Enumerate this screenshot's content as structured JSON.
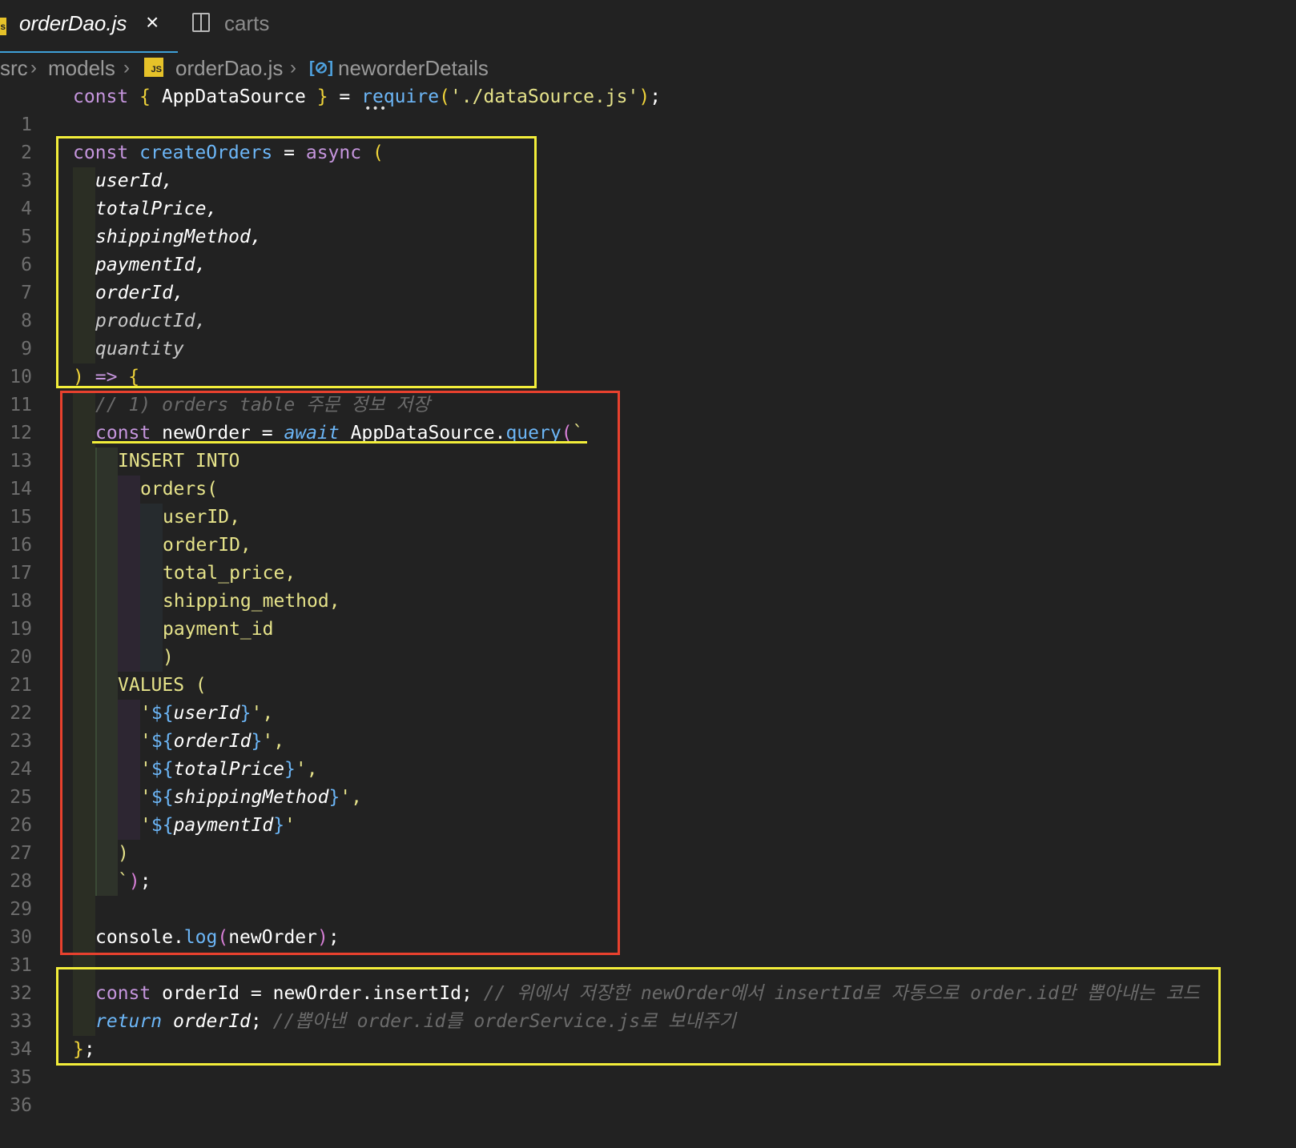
{
  "tabs": [
    {
      "label": "orderDao.js",
      "close_icon": "×"
    },
    {
      "label": "carts"
    }
  ],
  "breadcrumb": [
    "src",
    "models",
    "orderDao.js",
    "neworderDetails"
  ],
  "breadcrumb_sep": "›",
  "icons": {
    "js_file": "JS",
    "symbol": "[⊘]"
  },
  "lines": [
    {
      "n": "1"
    },
    {
      "n": "2"
    },
    {
      "n": "3"
    },
    {
      "n": "4"
    },
    {
      "n": "5"
    },
    {
      "n": "6"
    },
    {
      "n": "7"
    },
    {
      "n": "8"
    },
    {
      "n": "9"
    },
    {
      "n": "10"
    },
    {
      "n": "11"
    },
    {
      "n": "12"
    },
    {
      "n": "13"
    },
    {
      "n": "14"
    },
    {
      "n": "15"
    },
    {
      "n": "16"
    },
    {
      "n": "17"
    },
    {
      "n": "18"
    },
    {
      "n": "19"
    },
    {
      "n": "20"
    },
    {
      "n": "21"
    },
    {
      "n": "22"
    },
    {
      "n": "23"
    },
    {
      "n": "24"
    },
    {
      "n": "25"
    },
    {
      "n": "26"
    },
    {
      "n": "27"
    },
    {
      "n": "28"
    },
    {
      "n": "29"
    },
    {
      "n": "30"
    },
    {
      "n": "31"
    },
    {
      "n": "32"
    },
    {
      "n": "33"
    },
    {
      "n": "34"
    },
    {
      "n": "35"
    },
    {
      "n": "36"
    }
  ],
  "code": {
    "l1": {
      "const": "const",
      "open": "{",
      "name": "AppDataSource",
      "close": "}",
      "eq": "=",
      "req": "require",
      "p1": "(",
      "path": "'./dataSource.js'",
      "p2": ")",
      "semi": ";"
    },
    "l3": {
      "const": "const",
      "name": "createOrders",
      "eq": "=",
      "async": "async",
      "p": "("
    },
    "params": [
      "userId,",
      "totalPrice,",
      "shippingMethod,",
      "paymentId,",
      "orderId,",
      "productId,",
      "quantity"
    ],
    "l11": {
      "p": ")",
      "arrow": "=>",
      "brace": "{"
    },
    "l12": "// 1) orders table 주문 정보 저장",
    "l13": {
      "const": "const",
      "name": "newOrder",
      "eq": "=",
      "await": "await",
      "obj": "AppDataSource",
      "dot": ".",
      "fn": "query",
      "p": "(",
      "tick": "`"
    },
    "sql": [
      "INSERT INTO",
      "orders(",
      "userID,",
      "orderID,",
      "total_price,",
      "shipping_method,",
      "payment_id",
      ")",
      "VALUES ("
    ],
    "vals": [
      {
        "q1": "'",
        "d": "${",
        "v": "userId",
        "c": "}",
        "q2": "',"
      },
      {
        "q1": "'",
        "d": "${",
        "v": "orderId",
        "c": "}",
        "q2": "',"
      },
      {
        "q1": "'",
        "d": "${",
        "v": "totalPrice",
        "c": "}",
        "q2": "',"
      },
      {
        "q1": "'",
        "d": "${",
        "v": "shippingMethod",
        "c": "}",
        "q2": "',"
      },
      {
        "q1": "'",
        "d": "${",
        "v": "paymentId",
        "c": "}",
        "q2": "'"
      }
    ],
    "l28": ")",
    "l29": {
      "tick": "`",
      "p": ")",
      "semi": ";"
    },
    "l31": {
      "obj": "console",
      "dot": ".",
      "fn": "log",
      "p1": "(",
      "arg": "newOrder",
      "p2": ")",
      "semi": ";"
    },
    "l33": {
      "const": "const",
      "name": "orderId",
      "eq": "=",
      "rhs": "newOrder.insertId;",
      "cmt": "// 위에서 저장한 newOrder에서 insertId로 자동으로 order.id만 뽑아내는 코드"
    },
    "l34": {
      "ret": "return",
      "name": "orderId",
      "semi": ";",
      "cmt": "//뽑아낸 order.id를 orderService.js로 보내주기"
    },
    "l35": {
      "brace": "}",
      "semi": ";"
    }
  }
}
